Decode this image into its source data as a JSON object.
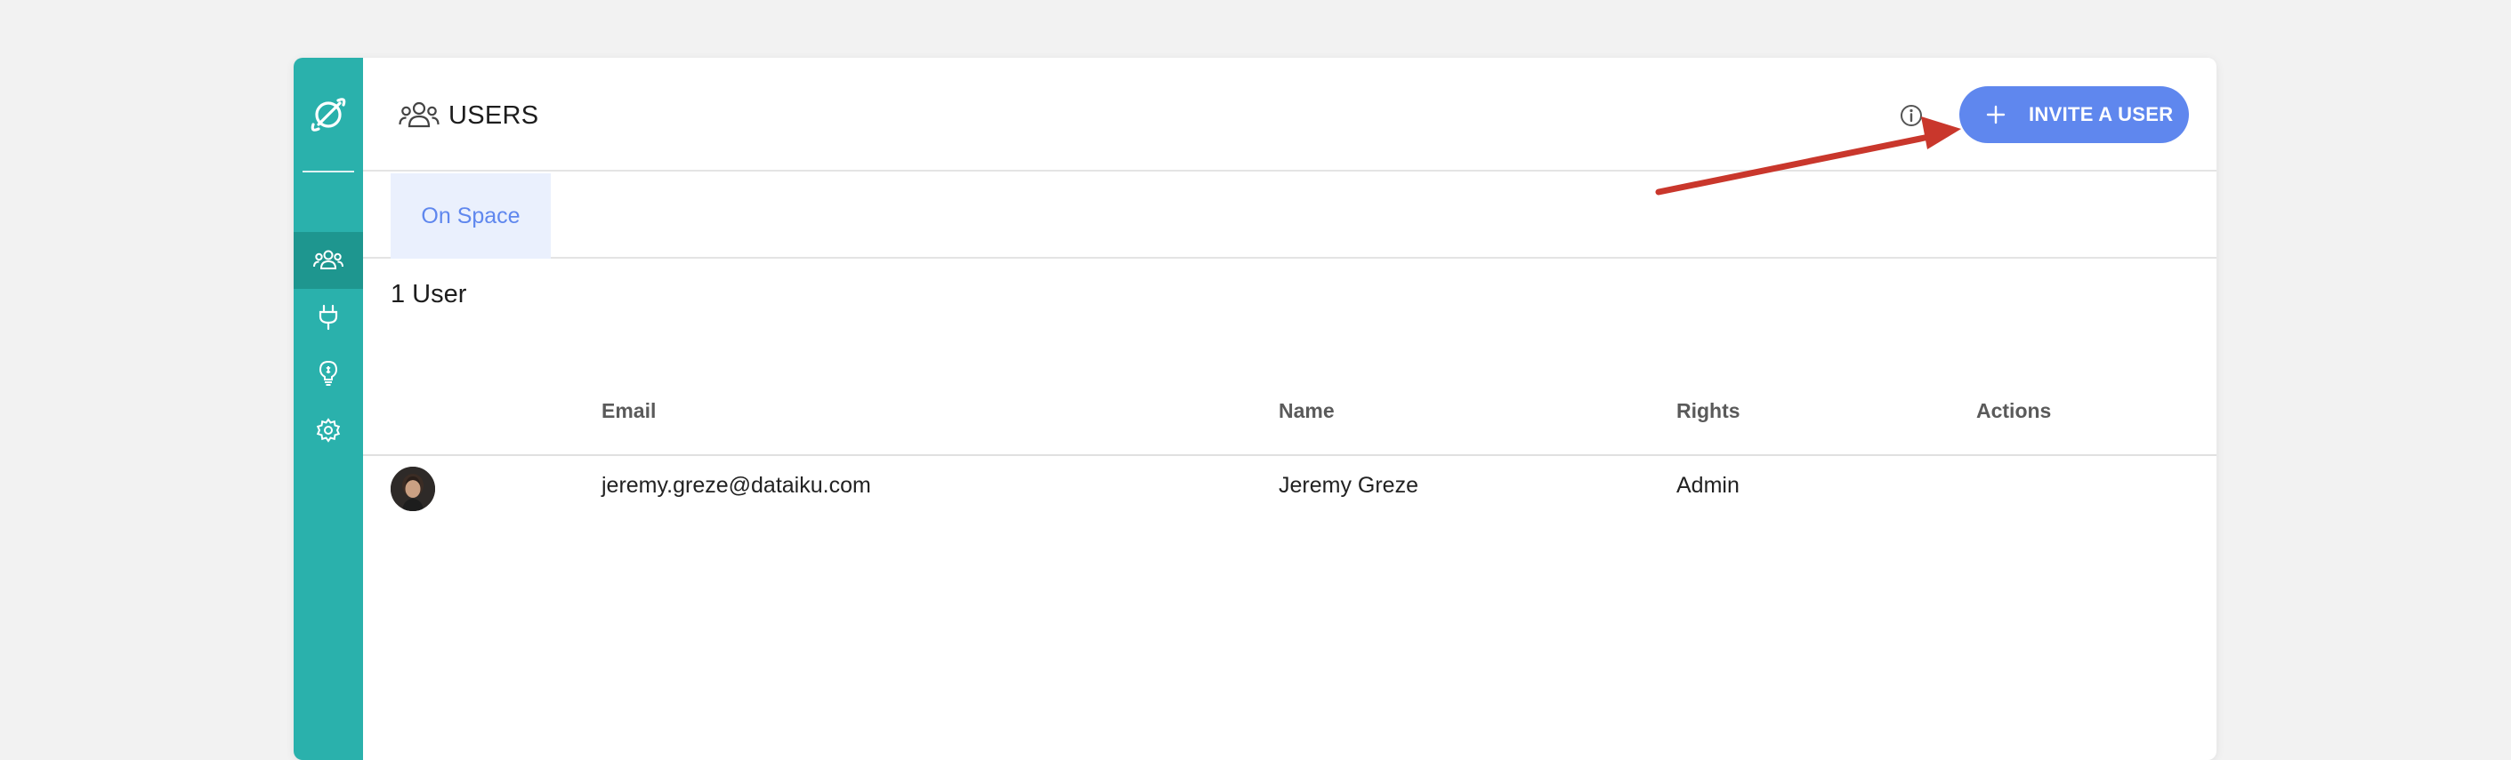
{
  "header": {
    "title": "USERS",
    "invite_button_label": "INVITE A USER"
  },
  "tabs": [
    {
      "label": "On Space",
      "active": true
    }
  ],
  "user_count": "1 User",
  "table": {
    "columns": [
      "Email",
      "Name",
      "Rights",
      "Actions"
    ],
    "rows": [
      {
        "email": "jeremy.greze@dataiku.com",
        "name": "Jeremy Greze",
        "rights": "Admin",
        "actions": ""
      }
    ]
  },
  "sidebar": {
    "items": [
      {
        "icon": "users-icon",
        "active": true
      },
      {
        "icon": "plug-icon",
        "active": false
      },
      {
        "icon": "lightbulb-icon",
        "active": false
      },
      {
        "icon": "gear-icon",
        "active": false
      }
    ]
  },
  "icons": {
    "logo": "planet-logo-icon",
    "title": "users-icon",
    "info": "info-icon",
    "invite": "plus-icon"
  },
  "colors": {
    "sidebar": "#2ab1ac",
    "sidebar_active": "#1e968f",
    "accent": "#5f87ee",
    "tab_bg": "#eaf0fd",
    "annotation_arrow": "#c9372c"
  }
}
